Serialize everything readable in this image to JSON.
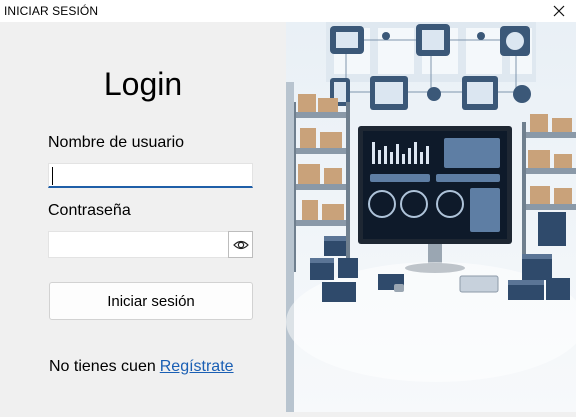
{
  "window": {
    "title": "INICIAR SESIÓN",
    "close_icon": "close-icon"
  },
  "form": {
    "heading": "Login",
    "username_label": "Nombre de usuario",
    "username_value": "",
    "password_label": "Contraseña",
    "password_value": "",
    "show_password_icon": "eye-icon",
    "submit_label": "Iniciar sesión",
    "signup_prompt": "No tienes cuen",
    "signup_link": "Regístrate"
  },
  "colors": {
    "accent": "#1f5fa8",
    "link": "#1a5fb4",
    "background": "#f0f0f0"
  }
}
